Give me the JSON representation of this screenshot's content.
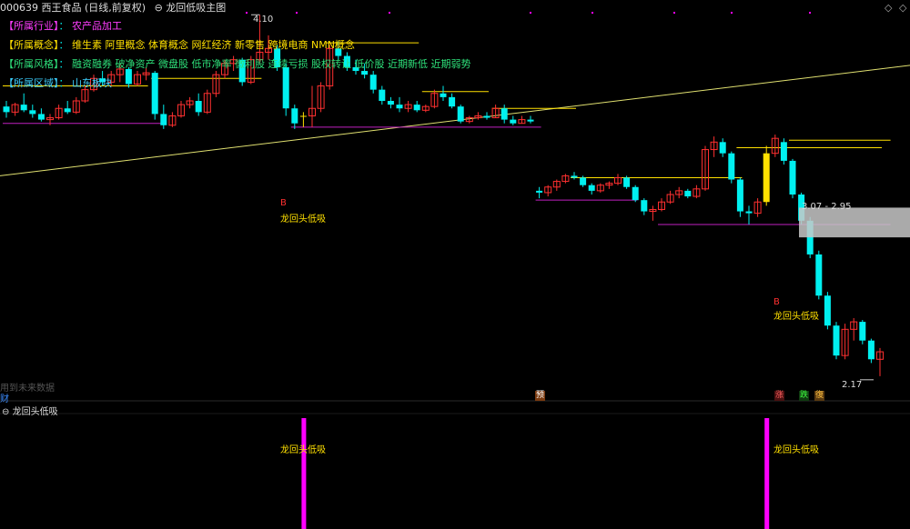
{
  "header": {
    "code": "000639",
    "name": "西王食品",
    "period": "(日线,前复权)",
    "indicator": "龙回低吸主图"
  },
  "info": {
    "industry": {
      "tag": "【所属行业】",
      "value": "农产品加工"
    },
    "concept": {
      "tag": "【所属概念】",
      "value": "维生素 阿里概念 体育概念 网红经济 新零售 跨境电商 NMN概念"
    },
    "style": {
      "tag": "【所属风格】",
      "value": "融资融券 破净资产 微盘股 低市净率 微利股 连续亏损 股权转让 低价股 近期新低 近期弱势"
    },
    "region": {
      "tag": "【所属区域】",
      "value": "山东板块"
    }
  },
  "labels": {
    "high": "4.10",
    "range": "3.07 - 2.95",
    "low": "2.17",
    "ghost": "用到未来数据",
    "cai": "财",
    "yu": "预",
    "zhang": "涨",
    "die": "跌",
    "fu": "復",
    "subpanel": "龙回头低吸",
    "signal_name": "龙回头低吸",
    "buy": "B"
  },
  "colors": {
    "up": "#ff3030",
    "down": "#00f0f0",
    "signal": "#ffe000",
    "support": "#c020c0",
    "trend": "#e0e070",
    "bar": "#ff00ff"
  },
  "chart_data": {
    "type": "candlestick",
    "title": "龙回低吸主图",
    "price_markers": {
      "high": 4.1,
      "range_top": 3.07,
      "range_bottom": 2.95,
      "low": 2.17
    },
    "ohlc": [
      [
        3.61,
        3.64,
        3.55,
        3.58
      ],
      [
        3.58,
        3.63,
        3.56,
        3.62
      ],
      [
        3.62,
        3.68,
        3.58,
        3.59
      ],
      [
        3.59,
        3.62,
        3.55,
        3.57
      ],
      [
        3.57,
        3.6,
        3.53,
        3.54
      ],
      [
        3.54,
        3.57,
        3.51,
        3.55
      ],
      [
        3.55,
        3.62,
        3.54,
        3.6
      ],
      [
        3.6,
        3.64,
        3.57,
        3.58
      ],
      [
        3.58,
        3.66,
        3.57,
        3.64
      ],
      [
        3.64,
        3.72,
        3.63,
        3.7
      ],
      [
        3.7,
        3.78,
        3.69,
        3.76
      ],
      [
        3.76,
        3.8,
        3.72,
        3.74
      ],
      [
        3.74,
        3.8,
        3.72,
        3.78
      ],
      [
        3.78,
        3.84,
        3.74,
        3.81
      ],
      [
        3.81,
        3.82,
        3.71,
        3.73
      ],
      [
        3.73,
        3.8,
        3.72,
        3.78
      ],
      [
        3.78,
        3.82,
        3.75,
        3.79
      ],
      [
        3.79,
        3.8,
        3.54,
        3.57
      ],
      [
        3.57,
        3.62,
        3.49,
        3.51
      ],
      [
        3.51,
        3.58,
        3.5,
        3.56
      ],
      [
        3.56,
        3.64,
        3.55,
        3.62
      ],
      [
        3.62,
        3.66,
        3.6,
        3.64
      ],
      [
        3.64,
        3.68,
        3.56,
        3.58
      ],
      [
        3.58,
        3.7,
        3.57,
        3.68
      ],
      [
        3.68,
        3.8,
        3.66,
        3.78
      ],
      [
        3.78,
        3.86,
        3.76,
        3.84
      ],
      [
        3.84,
        3.88,
        3.8,
        3.86
      ],
      [
        3.86,
        3.87,
        3.72,
        3.74
      ],
      [
        3.74,
        3.88,
        3.73,
        3.86
      ],
      [
        3.86,
        4.1,
        3.84,
        3.9
      ],
      [
        3.9,
        3.99,
        3.86,
        3.92
      ],
      [
        3.92,
        3.94,
        3.8,
        3.82
      ],
      [
        3.82,
        3.84,
        3.56,
        3.6
      ],
      [
        3.6,
        3.62,
        3.49,
        3.52
      ],
      [
        3.56,
        3.58,
        3.5,
        3.56
      ],
      [
        3.56,
        3.72,
        3.5,
        3.6
      ],
      [
        3.6,
        3.74,
        3.58,
        3.72
      ],
      [
        3.72,
        3.94,
        3.7,
        3.92
      ],
      [
        3.92,
        3.96,
        3.86,
        3.88
      ],
      [
        3.88,
        3.9,
        3.8,
        3.82
      ],
      [
        3.82,
        3.86,
        3.78,
        3.8
      ],
      [
        3.8,
        3.84,
        3.76,
        3.78
      ],
      [
        3.78,
        3.8,
        3.68,
        3.7
      ],
      [
        3.7,
        3.72,
        3.62,
        3.64
      ],
      [
        3.64,
        3.66,
        3.6,
        3.62
      ],
      [
        3.62,
        3.66,
        3.58,
        3.6
      ],
      [
        3.6,
        3.64,
        3.58,
        3.62
      ],
      [
        3.62,
        3.64,
        3.58,
        3.59
      ],
      [
        3.59,
        3.62,
        3.58,
        3.61
      ],
      [
        3.61,
        3.7,
        3.6,
        3.68
      ],
      [
        3.68,
        3.72,
        3.64,
        3.66
      ],
      [
        3.66,
        3.68,
        3.6,
        3.61
      ],
      [
        3.61,
        3.62,
        3.52,
        3.53
      ],
      [
        3.53,
        3.56,
        3.52,
        3.55
      ],
      [
        3.55,
        3.58,
        3.54,
        3.56
      ],
      [
        3.56,
        3.58,
        3.54,
        3.55
      ],
      [
        3.55,
        3.62,
        3.55,
        3.6
      ],
      [
        3.6,
        3.62,
        3.52,
        3.54
      ],
      [
        3.54,
        3.56,
        3.51,
        3.52
      ],
      [
        3.52,
        3.56,
        3.52,
        3.54
      ],
      [
        3.54,
        3.56,
        3.52,
        3.53
      ],
      [
        3.16,
        3.18,
        3.12,
        3.15
      ],
      [
        3.15,
        3.19,
        3.13,
        3.18
      ],
      [
        3.18,
        3.22,
        3.16,
        3.21
      ],
      [
        3.21,
        3.25,
        3.2,
        3.24
      ],
      [
        3.24,
        3.26,
        3.22,
        3.23
      ],
      [
        3.23,
        3.24,
        3.18,
        3.19
      ],
      [
        3.19,
        3.2,
        3.14,
        3.16
      ],
      [
        3.16,
        3.2,
        3.15,
        3.19
      ],
      [
        3.19,
        3.21,
        3.17,
        3.2
      ],
      [
        3.2,
        3.25,
        3.19,
        3.23
      ],
      [
        3.23,
        3.24,
        3.17,
        3.18
      ],
      [
        3.18,
        3.19,
        3.1,
        3.11
      ],
      [
        3.11,
        3.12,
        3.03,
        3.05
      ],
      [
        3.05,
        3.08,
        3.0,
        3.06
      ],
      [
        3.06,
        3.12,
        3.05,
        3.1
      ],
      [
        3.1,
        3.16,
        3.09,
        3.14
      ],
      [
        3.14,
        3.18,
        3.12,
        3.16
      ],
      [
        3.16,
        3.17,
        3.12,
        3.13
      ],
      [
        3.13,
        3.19,
        3.12,
        3.17
      ],
      [
        3.17,
        3.4,
        3.16,
        3.38
      ],
      [
        3.38,
        3.45,
        3.34,
        3.42
      ],
      [
        3.42,
        3.44,
        3.34,
        3.36
      ],
      [
        3.36,
        3.37,
        3.2,
        3.22
      ],
      [
        3.22,
        3.23,
        3.02,
        3.05
      ],
      [
        3.05,
        3.08,
        2.98,
        3.04
      ],
      [
        3.04,
        3.12,
        3.02,
        3.1
      ],
      [
        3.1,
        3.4,
        3.08,
        3.36
      ],
      [
        3.36,
        3.46,
        3.34,
        3.44
      ],
      [
        3.42,
        3.44,
        3.3,
        3.32
      ],
      [
        3.32,
        3.33,
        3.12,
        3.14
      ],
      [
        3.14,
        3.15,
        2.98,
        3.0
      ],
      [
        3.0,
        3.02,
        2.8,
        2.82
      ],
      [
        2.82,
        2.84,
        2.58,
        2.6
      ],
      [
        2.6,
        2.62,
        2.42,
        2.44
      ],
      [
        2.44,
        2.46,
        2.26,
        2.28
      ],
      [
        2.28,
        2.45,
        2.26,
        2.42
      ],
      [
        2.42,
        2.48,
        2.36,
        2.46
      ],
      [
        2.46,
        2.47,
        2.34,
        2.36
      ],
      [
        2.36,
        2.37,
        2.24,
        2.26
      ],
      [
        2.26,
        2.32,
        2.17,
        2.3
      ]
    ],
    "signals": [
      34,
      87
    ]
  }
}
